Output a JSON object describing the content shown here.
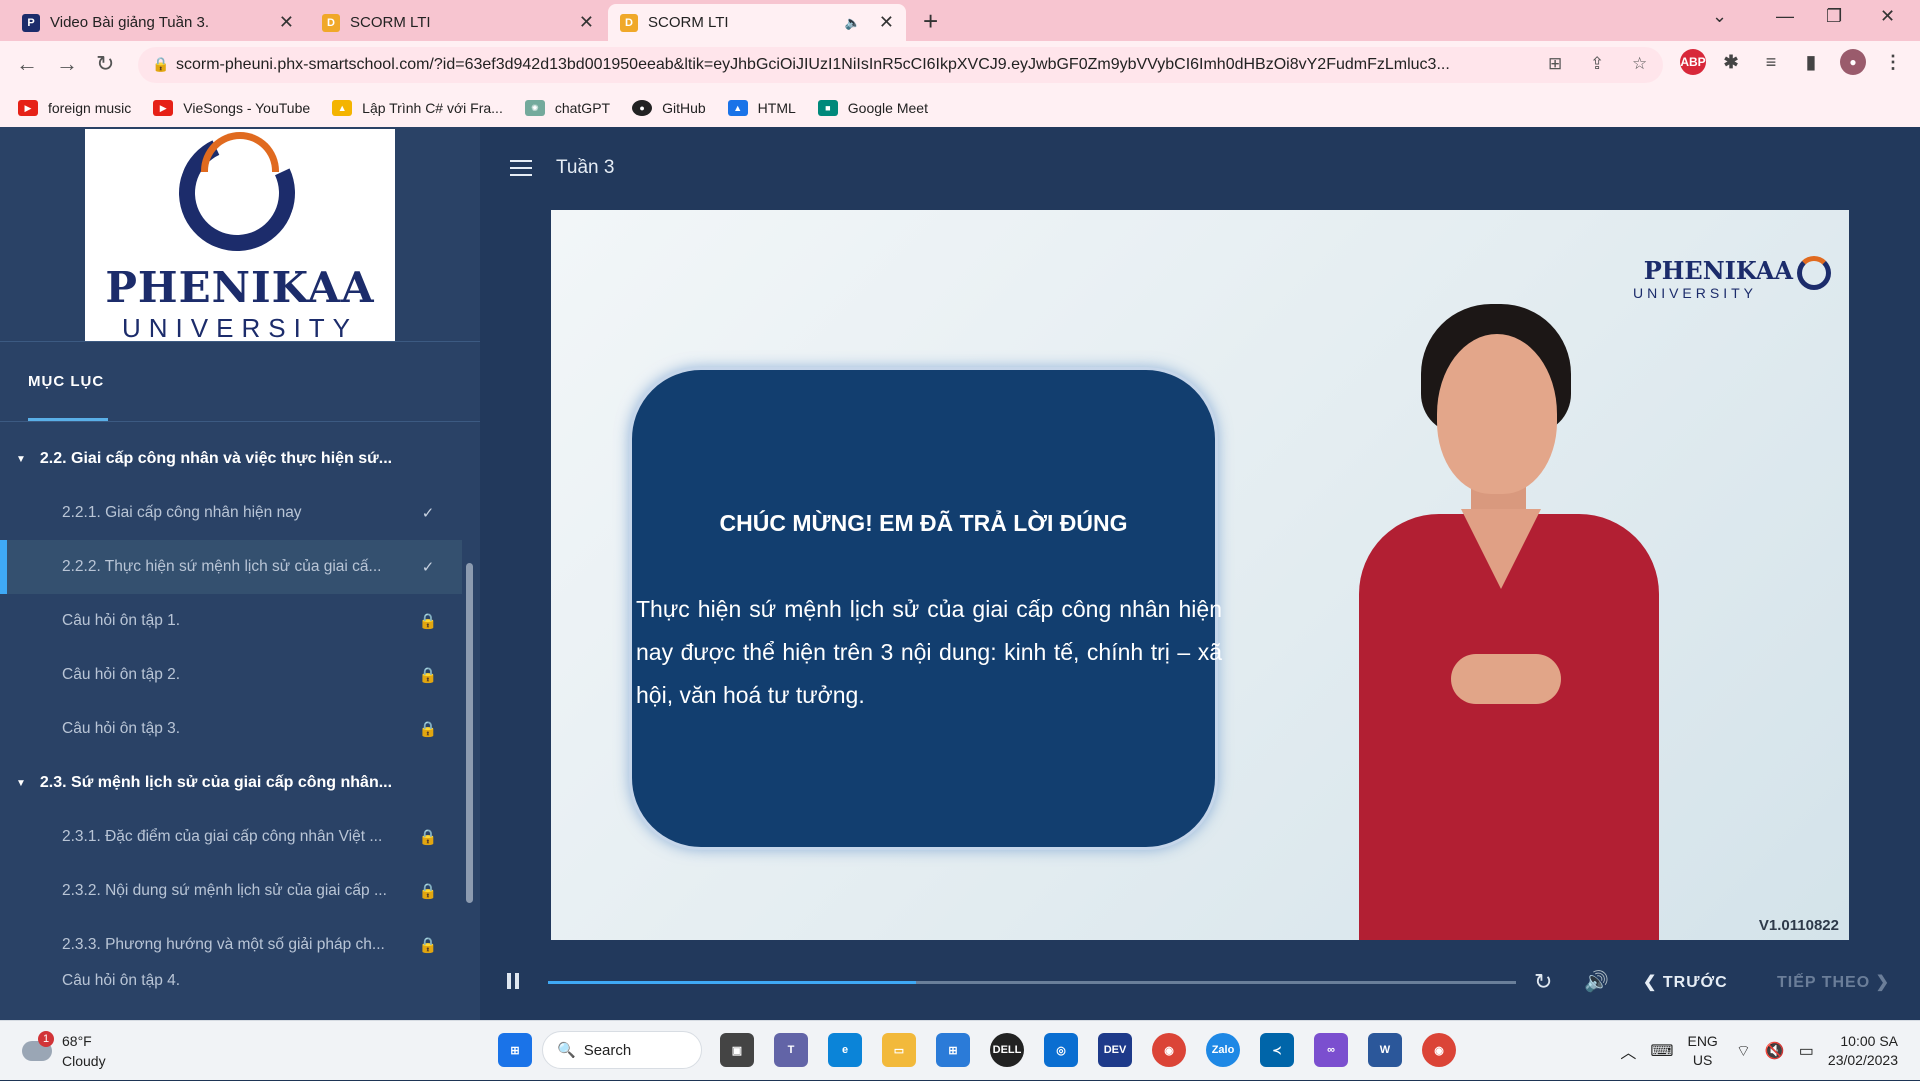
{
  "tabs": [
    {
      "title": "Video Bài giảng Tuần 3.",
      "active": false,
      "favicon": "phenikaa-icon"
    },
    {
      "title": "SCORM LTI",
      "active": false,
      "favicon": "d-icon"
    },
    {
      "title": "SCORM LTI",
      "active": true,
      "favicon": "d-icon"
    }
  ],
  "address": {
    "url": "scorm-pheuni.phx-smartschool.com/?id=63ef3d942d13bd001950eeab&ltik=eyJhbGciOiJIUzI1NiIsInR5cCI6IkpXVCJ9.eyJwbGF0Zm9ybVVybCI6Imh0dHBzOi8vY2FudmFzLmluc3..."
  },
  "bookmarks": [
    {
      "label": "foreign music",
      "icon": "youtube-icon"
    },
    {
      "label": "VieSongs - YouTube",
      "icon": "youtube-icon"
    },
    {
      "label": "Lập Trình C# với Fra...",
      "icon": "drive-icon"
    },
    {
      "label": "chatGPT",
      "icon": "openai-icon"
    },
    {
      "label": "GitHub",
      "icon": "github-icon"
    },
    {
      "label": "HTML",
      "icon": "drive-icon"
    },
    {
      "label": "Google Meet",
      "icon": "meet-icon"
    }
  ],
  "sidebar": {
    "logo_name": "PHENIKAA",
    "logo_sub": "UNIVERSITY",
    "toc_heading": "MỤC LỤC",
    "sections": [
      {
        "title": "2.2. Giai cấp công nhân và việc thực hiện sứ...",
        "items": [
          {
            "label": "2.2.1. Giai cấp công nhân hiện nay",
            "status": "done"
          },
          {
            "label": "2.2.2. Thực hiện sứ mệnh lịch sử của giai cấ...",
            "status": "done"
          },
          {
            "label": "Câu hỏi ôn tập 1.",
            "status": "locked"
          },
          {
            "label": "Câu hỏi ôn tập 2.",
            "status": "locked"
          },
          {
            "label": "Câu hỏi ôn tập 3.",
            "status": "locked"
          }
        ]
      },
      {
        "title": "2.3. Sứ mệnh lịch sử của giai cấp công nhân...",
        "items": [
          {
            "label": "2.3.1. Đặc điểm của giai cấp công nhân Việt ...",
            "status": "locked"
          },
          {
            "label": "2.3.2. Nội dung sứ mệnh lịch sử của giai cấp ...",
            "status": "locked"
          },
          {
            "label": "2.3.3. Phương hướng và một số giải pháp ch...",
            "status": "locked"
          },
          {
            "label": "Câu hỏi ôn tập 4.",
            "status": "locked"
          }
        ]
      }
    ]
  },
  "main": {
    "course_title": "Tuần 3",
    "video": {
      "brand_name": "PHENIKAA",
      "brand_sub": "UNIVERSITY",
      "card_title": "CHÚC MỪNG! EM ĐÃ TRẢ LỜI ĐÚNG",
      "card_body": "Thực hiện sứ mệnh lịch sử của giai cấp công nhân hiện nay được thể hiện trên 3 nội dung: kinh tế, chính trị – xã hội, văn hoá tư tưởng.",
      "version": "V1.0110822"
    },
    "controls": {
      "progress": 0.38,
      "prev_label": "TRƯỚC",
      "next_label": "TIẾP THEO"
    }
  },
  "taskbar": {
    "weather_temp": "68°F",
    "weather_desc": "Cloudy",
    "weather_badge": "1",
    "search_label": "Search",
    "lang_line1": "ENG",
    "lang_line2": "US",
    "time": "10:00 SA",
    "date": "23/02/2023"
  },
  "colors": {
    "accent": "#3fa9f5",
    "sidebar": "#2a4266",
    "card": "#123e6f",
    "brand": "#1c2c6b",
    "tabbar": "#f7c5d0"
  }
}
